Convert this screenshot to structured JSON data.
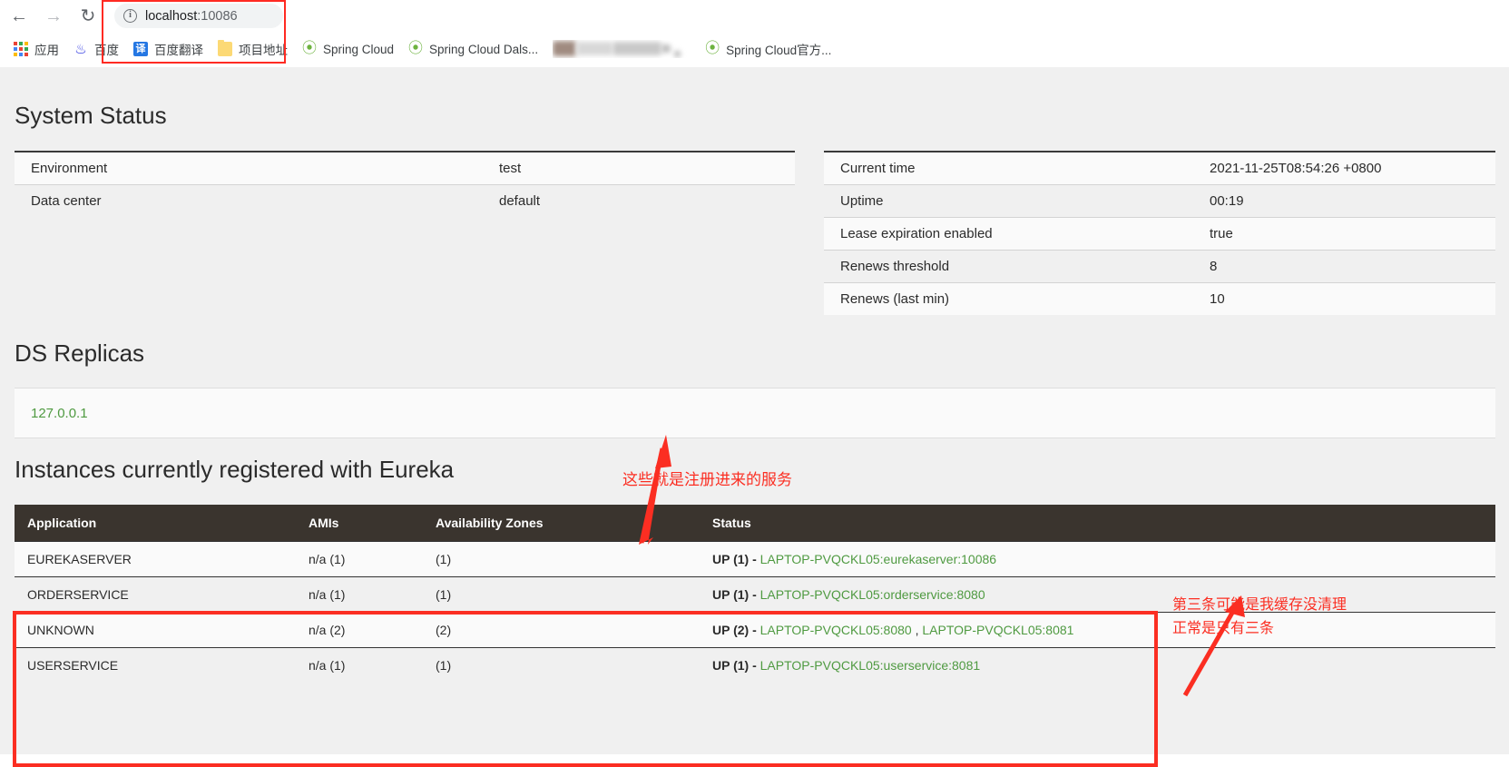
{
  "browser": {
    "nav": {
      "back_icon": "arrow-left-icon",
      "forward_icon": "arrow-right-icon",
      "reload_icon": "reload-icon"
    },
    "omnibox": {
      "security_icon": "info-circle-icon",
      "url_host": "localhost",
      "url_port": ":10086",
      "full_url": "localhost:10086"
    },
    "bookmarks": [
      {
        "label": "应用",
        "icon": "apps-grid-icon"
      },
      {
        "label": "百度",
        "icon": "baidu-paw-icon"
      },
      {
        "label": "百度翻译",
        "icon": "translate-icon"
      },
      {
        "label": "项目地址",
        "icon": "folder-icon"
      },
      {
        "label": "Spring Cloud",
        "icon": "spring-leaf-icon"
      },
      {
        "label": "Spring Cloud Dals...",
        "icon": "spring-leaf-icon"
      },
      {
        "label": "",
        "icon": "blurred-bookmark"
      },
      {
        "label": "Spring Cloud官方...",
        "icon": "spring-leaf-icon"
      }
    ],
    "highlight_color": "#ff2a22"
  },
  "page": {
    "system_status": {
      "title": "System Status",
      "left_rows": [
        {
          "key": "Environment",
          "value": "test"
        },
        {
          "key": "Data center",
          "value": "default"
        }
      ],
      "right_rows": [
        {
          "key": "Current time",
          "value": "2021-11-25T08:54:26 +0800"
        },
        {
          "key": "Uptime",
          "value": "00:19"
        },
        {
          "key": "Lease expiration enabled",
          "value": "true"
        },
        {
          "key": "Renews threshold",
          "value": "8"
        },
        {
          "key": "Renews (last min)",
          "value": "10"
        }
      ]
    },
    "ds_replicas": {
      "title": "DS Replicas",
      "items": [
        "127.0.0.1"
      ]
    },
    "instances": {
      "title": "Instances currently registered with Eureka",
      "columns": [
        "Application",
        "AMIs",
        "Availability Zones",
        "Status"
      ],
      "rows": [
        {
          "application": "EUREKASERVER",
          "amis": "n/a (1)",
          "zones": "(1)",
          "status_prefix": "UP (1) - ",
          "links": [
            "LAPTOP-PVQCKL05:eurekaserver:10086"
          ]
        },
        {
          "application": "ORDERSERVICE",
          "amis": "n/a (1)",
          "zones": "(1)",
          "status_prefix": "UP (1) - ",
          "links": [
            "LAPTOP-PVQCKL05:orderservice:8080"
          ]
        },
        {
          "application": "UNKNOWN",
          "amis": "n/a (2)",
          "zones": "(2)",
          "status_prefix": "UP (2) - ",
          "links": [
            "LAPTOP-PVQCKL05:8080",
            "LAPTOP-PVQCKL05:8081"
          ]
        },
        {
          "application": "USERSERVICE",
          "amis": "n/a (1)",
          "zones": "(1)",
          "status_prefix": "UP (1) - ",
          "links": [
            "LAPTOP-PVQCKL05:userservice:8081"
          ]
        }
      ]
    }
  },
  "annotations": {
    "color": "#fb2e22",
    "note_services": "这些就是注册进来的服务",
    "note_cache_line1": "第三条可能是我缓存没清理",
    "note_cache_line2": "正常是只有三条"
  },
  "colors": {
    "link_green": "#4f9a41",
    "header_dark": "#3a342e",
    "page_bg": "#f0f0f0",
    "row_light": "#fafafa"
  }
}
